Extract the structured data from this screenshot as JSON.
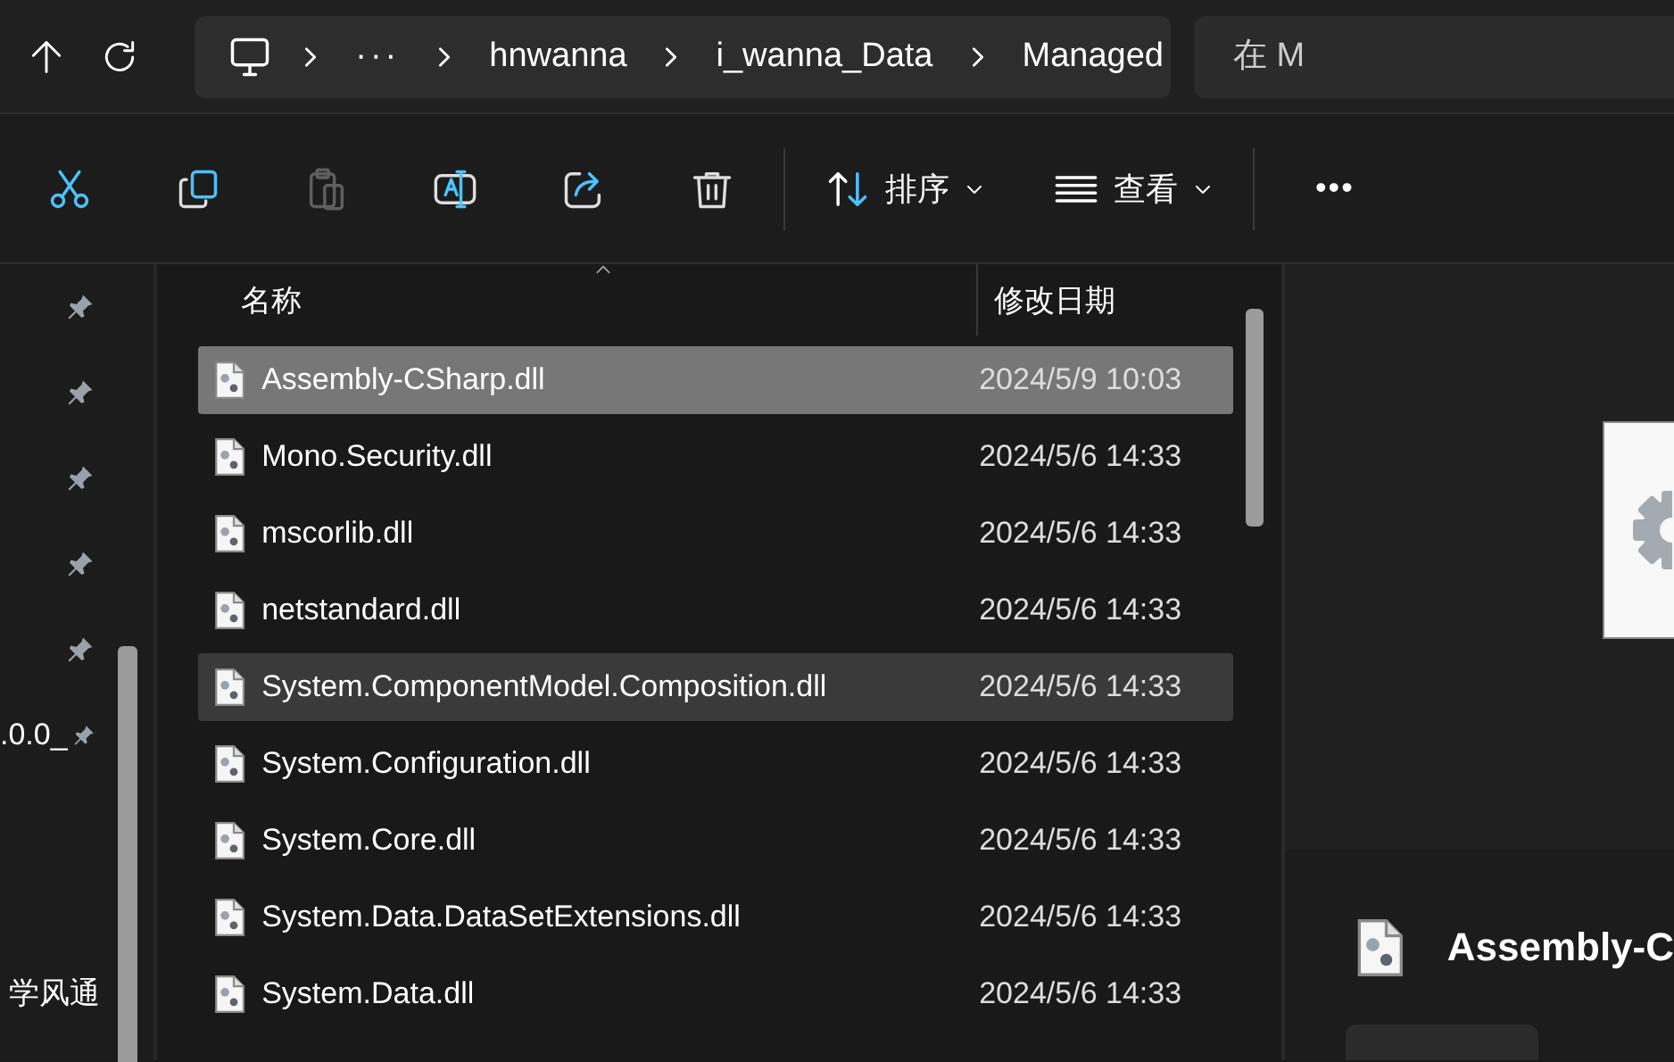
{
  "nav_buttons": [
    {
      "kind": "up"
    },
    {
      "kind": "refresh"
    }
  ],
  "breadcrumb": {
    "items": [
      {
        "kind": "computer"
      },
      {
        "kind": "overflow",
        "label": "···"
      },
      {
        "kind": "folder",
        "label": "hnwanna"
      },
      {
        "kind": "folder",
        "label": "i_wanna_Data"
      },
      {
        "kind": "folder",
        "label": "Managed"
      }
    ]
  },
  "search": {
    "placeholder": "在 M"
  },
  "toolbar": {
    "actions": [
      {
        "kind": "cut",
        "disabled": false
      },
      {
        "kind": "copy",
        "disabled": false
      },
      {
        "kind": "paste",
        "disabled": true
      },
      {
        "kind": "rename",
        "disabled": false
      },
      {
        "kind": "share",
        "disabled": false
      },
      {
        "kind": "delete",
        "disabled": false
      }
    ],
    "menus": [
      {
        "kind": "sort",
        "label": "排序"
      },
      {
        "kind": "view",
        "label": "查看"
      }
    ],
    "more": "•••"
  },
  "sidebar": {
    "items": [
      {
        "pinned": true
      },
      {
        "pinned": true
      },
      {
        "pinned": true
      },
      {
        "pinned": true
      },
      {
        "pinned": true
      },
      {
        "label": ".0.0_",
        "pinned": true
      },
      {
        "pinned": false
      },
      {
        "pinned": false
      },
      {
        "label": "学风通",
        "pinned": false
      }
    ]
  },
  "table": {
    "columns": [
      "名称",
      "修改日期"
    ],
    "rows": [
      {
        "name": "Assembly-CSharp.dll",
        "modified": "2024/5/9 10:03",
        "selected": true,
        "hovered": false
      },
      {
        "name": "Mono.Security.dll",
        "modified": "2024/5/6 14:33",
        "selected": false,
        "hovered": false
      },
      {
        "name": "mscorlib.dll",
        "modified": "2024/5/6 14:33",
        "selected": false,
        "hovered": false
      },
      {
        "name": "netstandard.dll",
        "modified": "2024/5/6 14:33",
        "selected": false,
        "hovered": false
      },
      {
        "name": "System.ComponentModel.Composition.dll",
        "modified": "2024/5/6 14:33",
        "selected": false,
        "hovered": true
      },
      {
        "name": "System.Configuration.dll",
        "modified": "2024/5/6 14:33",
        "selected": false,
        "hovered": false
      },
      {
        "name": "System.Core.dll",
        "modified": "2024/5/6 14:33",
        "selected": false,
        "hovered": false
      },
      {
        "name": "System.Data.DataSetExtensions.dll",
        "modified": "2024/5/6 14:33",
        "selected": false,
        "hovered": false
      },
      {
        "name": "System.Data.dll",
        "modified": "2024/5/6 14:33",
        "selected": false,
        "hovered": false
      }
    ]
  },
  "details": {
    "title": "Assembly-C"
  }
}
